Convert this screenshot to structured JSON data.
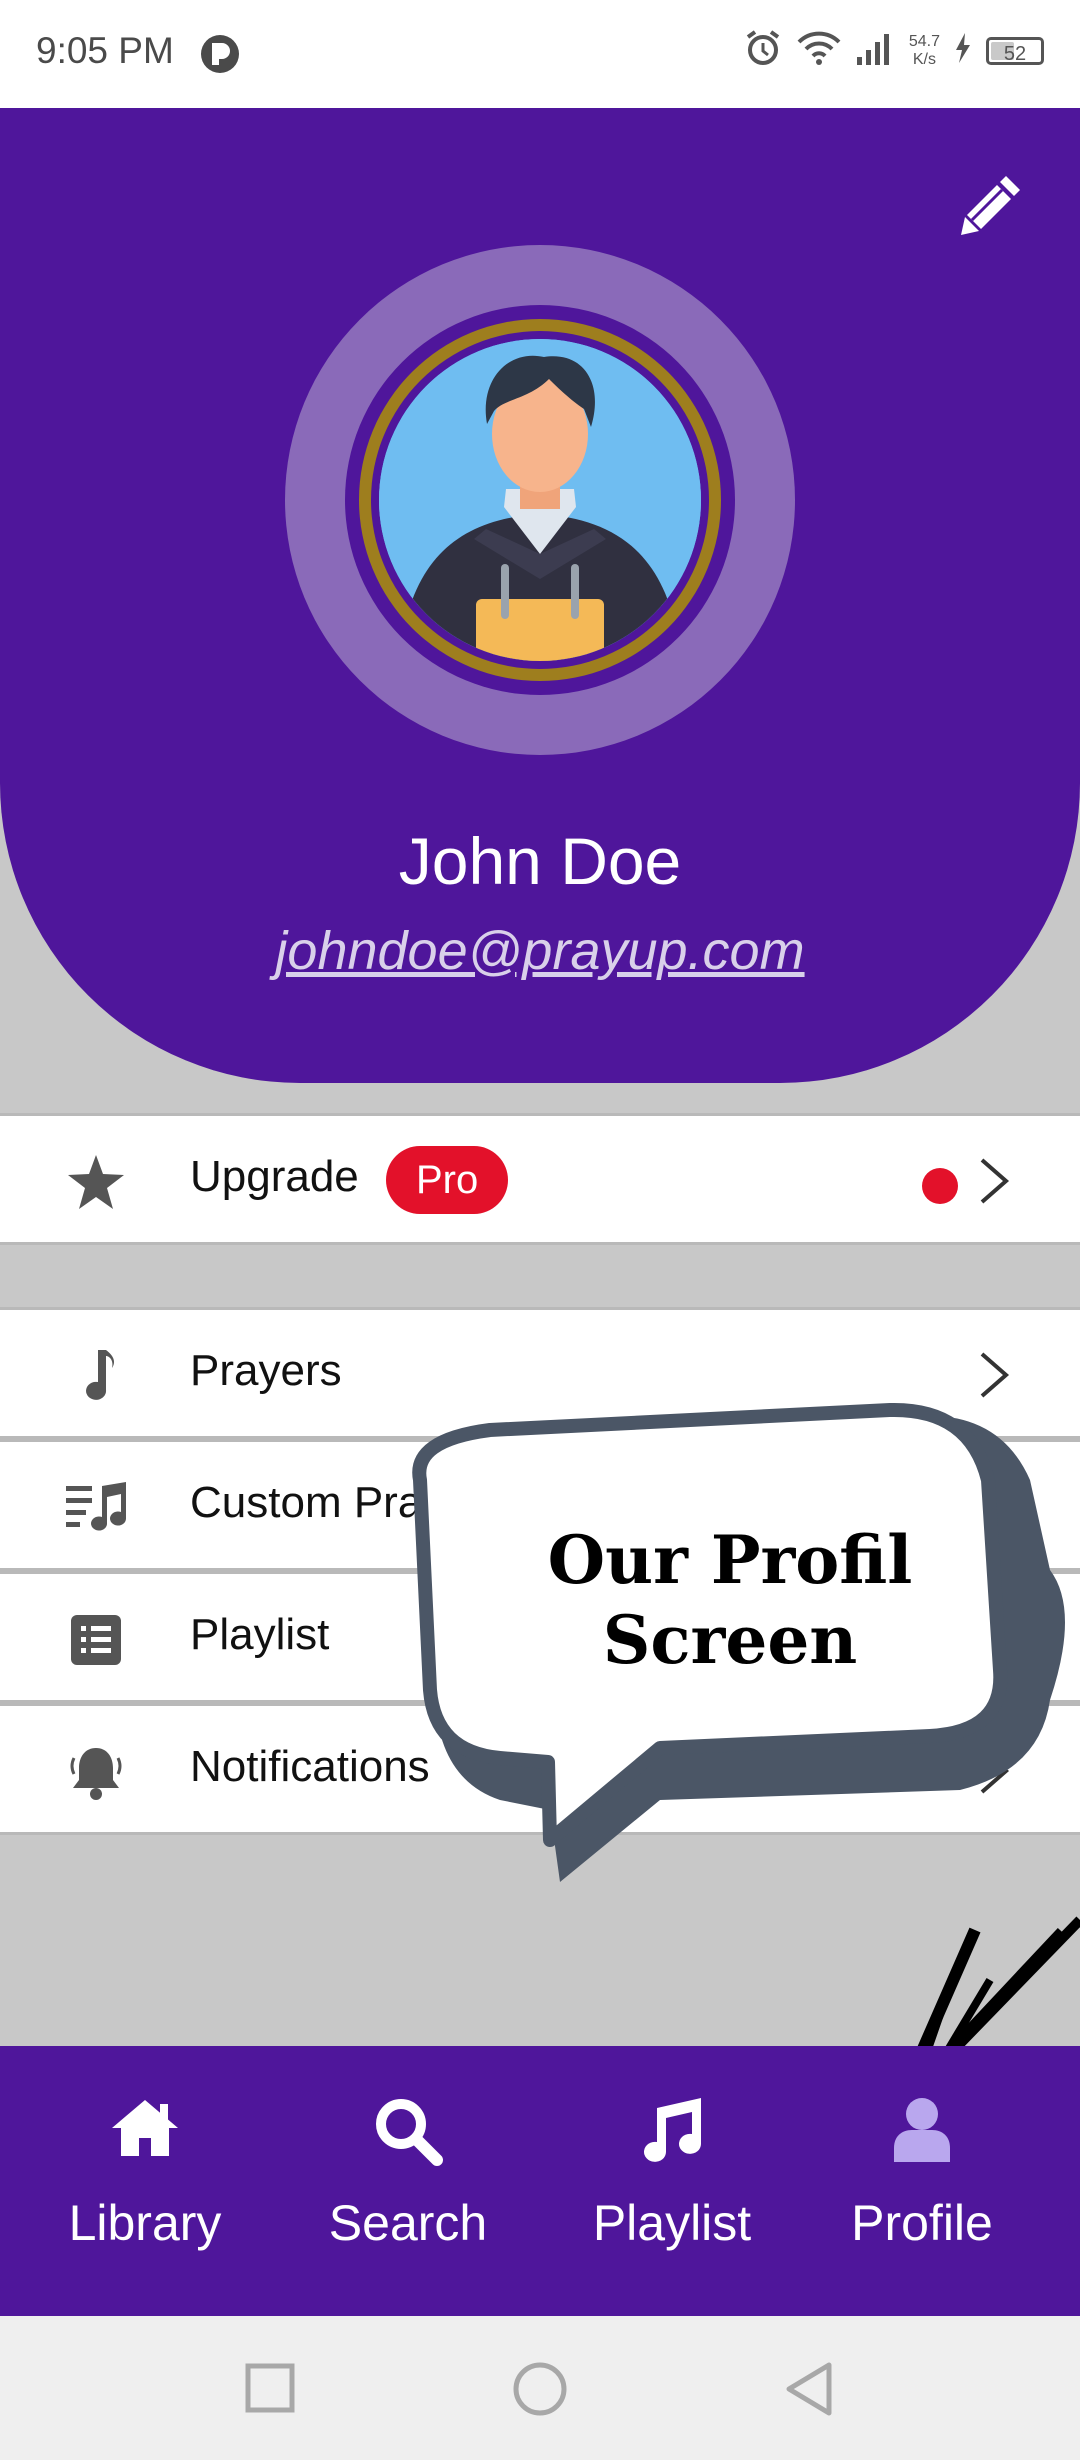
{
  "status_bar": {
    "time": "9:05 PM",
    "net_speed_value": "54.7",
    "net_speed_unit": "K/s",
    "battery_level": "52",
    "battery_fraction": 0.52,
    "icons": [
      "app-notification-icon",
      "alarm-icon",
      "wifi-icon",
      "signal-icon",
      "charging-icon",
      "battery-icon"
    ]
  },
  "profile": {
    "name": "John Doe",
    "email": "johndoe@prayup.com",
    "edit_icon": "pencil-icon"
  },
  "menu": {
    "upgrade": {
      "label": "Upgrade",
      "badge": "Pro",
      "icon": "star-icon"
    },
    "items": [
      {
        "label": "Prayers",
        "icon": "music-note-icon"
      },
      {
        "label": "Custom Prayers",
        "icon": "music-list-icon"
      },
      {
        "label": "Playlist",
        "icon": "list-icon"
      },
      {
        "label": "Notifications",
        "icon": "bell-icon"
      }
    ]
  },
  "callout": {
    "line1": "Our Profil",
    "line2": "Screen"
  },
  "bottom_nav": {
    "items": [
      {
        "label": "Library",
        "icon": "home-icon"
      },
      {
        "label": "Search",
        "icon": "search-icon"
      },
      {
        "label": "Playlist",
        "icon": "music-icon"
      },
      {
        "label": "Profile",
        "icon": "user-icon"
      }
    ],
    "active": "Profile"
  },
  "colors": {
    "primary": "#4f169b",
    "accent_red": "#e3112a",
    "active_nav_icon": "#b9a7ee",
    "background": "#c8c8c8"
  }
}
